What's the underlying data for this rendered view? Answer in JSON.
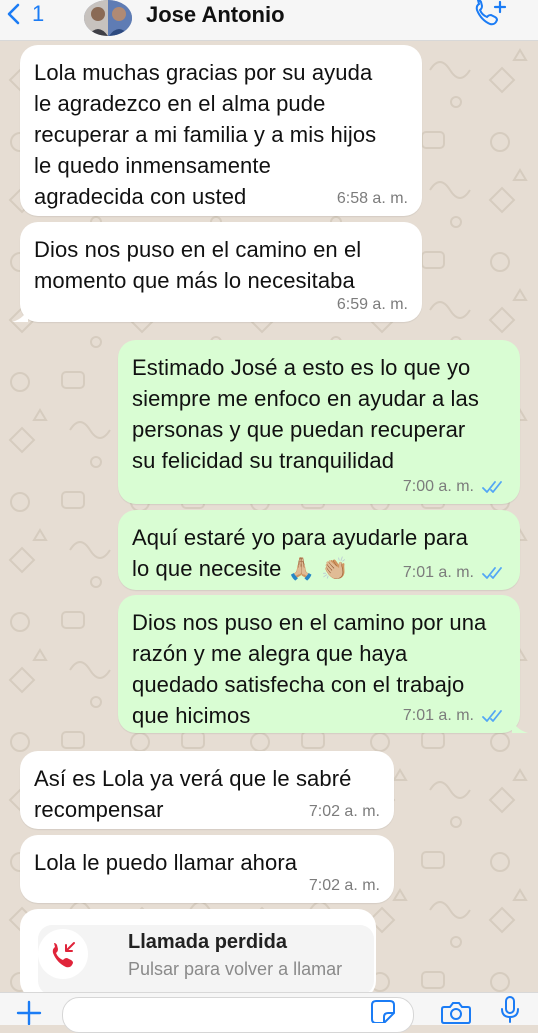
{
  "header": {
    "back_count": "1",
    "contact_name": "Jose Antonio"
  },
  "messages": [
    {
      "direction": "in",
      "text": "Lola muchas gracias por su ayuda\nle agradezco en el alma pude\nrecuperar a mi familia y a mis hijos\nle quedo inmensamente\nagradecida con usted",
      "time": "6:58 a. m."
    },
    {
      "direction": "in",
      "text": "Dios nos puso en el camino en el\nmomento que más lo necesitaba",
      "time": "6:59 a. m."
    },
    {
      "direction": "out",
      "text": "Estimado José a esto es lo que yo\nsiempre me enfoco en ayudar a las\npersonas y que puedan recuperar\nsu felicidad su tranquilidad",
      "time": "7:00 a. m.",
      "status": "read"
    },
    {
      "direction": "out",
      "text": "Aquí estaré yo para ayudarle para\nlo que necesite",
      "emoji": "🙏🏼 👏🏼",
      "time": "7:01 a. m.",
      "status": "read"
    },
    {
      "direction": "out",
      "text": "Dios nos puso en el camino por una\nrazón y me alegra que haya\nquedado satisfecha con el trabajo\nque hicimos",
      "time": "7:01 a. m.",
      "status": "read"
    },
    {
      "direction": "in",
      "text": "Así es Lola ya verá que le sabré\nrecompensar",
      "time": "7:02 a. m."
    },
    {
      "direction": "in",
      "text": "Lola le puedo llamar ahora",
      "time": "7:02 a. m."
    }
  ],
  "missed_call": {
    "title": "Llamada perdida",
    "subtitle": "Pulsar para volver a llamar"
  },
  "icons": {
    "back": "chevron-left-icon",
    "call": "phone-plus-icon",
    "plus": "plus-icon",
    "sticker": "sticker-icon",
    "camera": "camera-icon",
    "mic": "microphone-icon",
    "read_receipt": "double-check-icon",
    "missed_call": "missed-call-icon"
  },
  "colors": {
    "accent": "#1b7cf5",
    "outgoing_bubble": "#d9fdd3",
    "incoming_bubble": "#ffffff",
    "chat_background": "#e6ddd3",
    "read_ticks": "#53a6f5",
    "missed_call_red": "#e0243a"
  }
}
